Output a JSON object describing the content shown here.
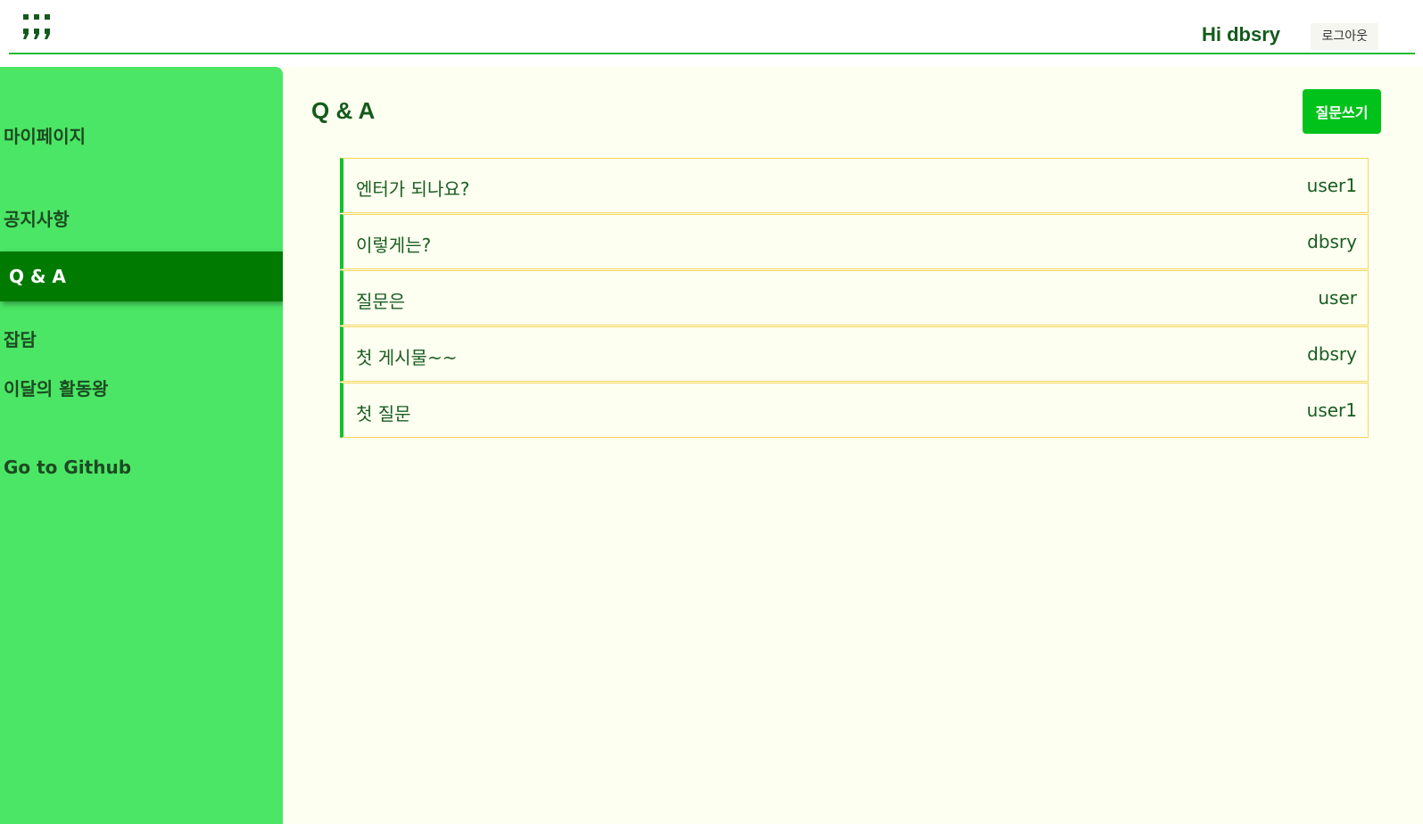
{
  "header": {
    "logo_icon": "quote-dots-icon",
    "greeting": "Hi dbsry",
    "logout_label": "로그아웃",
    "accent_color": "#22bb33"
  },
  "sidebar": {
    "background": "#4be665",
    "active_background": "#007a00",
    "items": [
      {
        "label": "마이페이지",
        "active": false
      },
      {
        "label": "공지사항",
        "active": false
      },
      {
        "label": "Q & A",
        "active": true
      },
      {
        "label": "잡담",
        "active": false
      },
      {
        "label": "이달의 활동왕",
        "active": false
      },
      {
        "label": "Go to Github",
        "active": false
      }
    ]
  },
  "main": {
    "title": "Q & A",
    "write_button_label": "질문쓰기",
    "posts": [
      {
        "title": "엔터가 되나요?",
        "author": "user1"
      },
      {
        "title": "이렇게는?",
        "author": "dbsry"
      },
      {
        "title": "질문은",
        "author": "user"
      },
      {
        "title": "첫 게시물~~",
        "author": "dbsry"
      },
      {
        "title": "첫 질문",
        "author": "user1"
      }
    ]
  }
}
